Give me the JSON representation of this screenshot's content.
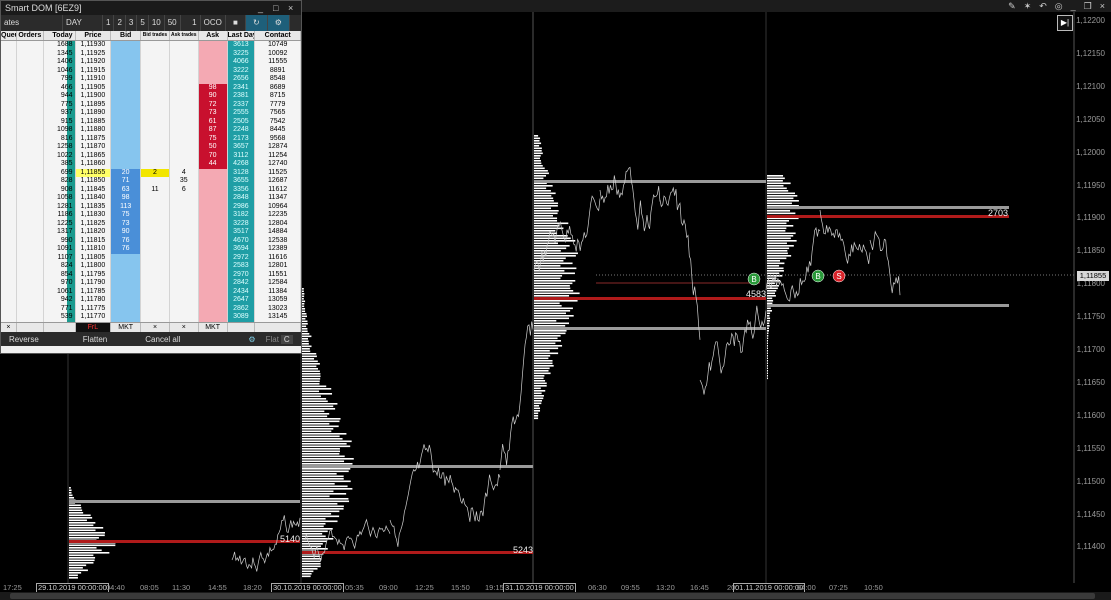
{
  "window": {
    "title": "Smart DOM [6EZ9]",
    "controls": [
      "_",
      "□",
      "×"
    ]
  },
  "dom_toolbar": {
    "account": "ates",
    "period": "DAY",
    "quantities": [
      "1",
      "2",
      "3",
      "5",
      "10",
      "50"
    ],
    "quantity_value": "1",
    "oco": "OCO"
  },
  "dom_columns": [
    "Queue",
    "Orders",
    "Today",
    "Price",
    "Bid",
    "Bid trades",
    "Ask trades",
    "Ask",
    "Last Day",
    "Contact"
  ],
  "dom_rows": [
    {
      "today": "1688",
      "price": "1,11930",
      "bid": "",
      "bidtr": "",
      "asktr": "",
      "ask": "",
      "last": "3613",
      "contact": "10749"
    },
    {
      "today": "1345",
      "price": "1,11925",
      "bid": "",
      "bidtr": "",
      "asktr": "",
      "ask": "",
      "last": "3225",
      "contact": "10092"
    },
    {
      "today": "1406",
      "price": "1,11920",
      "bid": "",
      "bidtr": "",
      "asktr": "",
      "ask": "",
      "last": "4066",
      "contact": "11555"
    },
    {
      "today": "1046",
      "price": "1,11915",
      "bid": "",
      "bidtr": "",
      "asktr": "",
      "ask": "",
      "last": "3222",
      "contact": "8891"
    },
    {
      "today": "799",
      "price": "1,11910",
      "bid": "",
      "bidtr": "",
      "asktr": "",
      "ask": "",
      "last": "2656",
      "contact": "8548"
    },
    {
      "today": "466",
      "price": "1,11905",
      "bid": "",
      "bidtr": "",
      "asktr": "",
      "ask": "98",
      "last": "2341",
      "contact": "8689"
    },
    {
      "today": "944",
      "price": "1,11900",
      "bid": "",
      "bidtr": "",
      "asktr": "",
      "ask": "90",
      "last": "2381",
      "contact": "8715"
    },
    {
      "today": "775",
      "price": "1,11895",
      "bid": "",
      "bidtr": "",
      "asktr": "",
      "ask": "72",
      "last": "2337",
      "contact": "7779"
    },
    {
      "today": "937",
      "price": "1,11890",
      "bid": "",
      "bidtr": "",
      "asktr": "",
      "ask": "73",
      "last": "2555",
      "contact": "7565"
    },
    {
      "today": "915",
      "price": "1,11885",
      "bid": "",
      "bidtr": "",
      "asktr": "",
      "ask": "61",
      "last": "2505",
      "contact": "7542"
    },
    {
      "today": "1098",
      "price": "1,11880",
      "bid": "",
      "bidtr": "",
      "asktr": "",
      "ask": "87",
      "last": "2248",
      "contact": "8445"
    },
    {
      "today": "816",
      "price": "1,11875",
      "bid": "",
      "bidtr": "",
      "asktr": "",
      "ask": "75",
      "last": "2173",
      "contact": "9568"
    },
    {
      "today": "1258",
      "price": "1,11870",
      "bid": "",
      "bidtr": "",
      "asktr": "",
      "ask": "50",
      "last": "3657",
      "contact": "12874"
    },
    {
      "today": "1022",
      "price": "1,11865",
      "bid": "",
      "bidtr": "",
      "asktr": "",
      "ask": "70",
      "last": "3112",
      "contact": "11254"
    },
    {
      "today": "385",
      "price": "1,11860",
      "bid": "",
      "bidtr": "",
      "asktr": "",
      "ask": "44",
      "last": "4268",
      "contact": "12740"
    },
    {
      "today": "699",
      "price": "1,11855",
      "bid": "20",
      "bidtr": "2",
      "asktr": "4",
      "ask": "",
      "last": "3128",
      "contact": "11525"
    },
    {
      "today": "828",
      "price": "1,11850",
      "bid": "71",
      "bidtr": "",
      "asktr": "35",
      "ask": "",
      "last": "3655",
      "contact": "12687"
    },
    {
      "today": "908",
      "price": "1,11845",
      "bid": "63",
      "bidtr": "11",
      "asktr": "6",
      "ask": "",
      "last": "3356",
      "contact": "11612"
    },
    {
      "today": "1058",
      "price": "1,11840",
      "bid": "98",
      "bidtr": "",
      "asktr": "",
      "ask": "",
      "last": "2848",
      "contact": "11347"
    },
    {
      "today": "1281",
      "price": "1,11835",
      "bid": "113",
      "bidtr": "",
      "asktr": "",
      "ask": "",
      "last": "2986",
      "contact": "10964"
    },
    {
      "today": "1186",
      "price": "1,11830",
      "bid": "75",
      "bidtr": "",
      "asktr": "",
      "ask": "",
      "last": "3182",
      "contact": "12235"
    },
    {
      "today": "1225",
      "price": "1,11825",
      "bid": "73",
      "bidtr": "",
      "asktr": "",
      "ask": "",
      "last": "3228",
      "contact": "12804"
    },
    {
      "today": "1317",
      "price": "1,11820",
      "bid": "90",
      "bidtr": "",
      "asktr": "",
      "ask": "",
      "last": "3517",
      "contact": "14884"
    },
    {
      "today": "990",
      "price": "1,11815",
      "bid": "76",
      "bidtr": "",
      "asktr": "",
      "ask": "",
      "last": "4670",
      "contact": "12538"
    },
    {
      "today": "1091",
      "price": "1,11810",
      "bid": "76",
      "bidtr": "",
      "asktr": "",
      "ask": "",
      "last": "3694",
      "contact": "12389"
    },
    {
      "today": "1107",
      "price": "1,11805",
      "bid": "",
      "bidtr": "",
      "asktr": "",
      "ask": "",
      "last": "2972",
      "contact": "11616"
    },
    {
      "today": "824",
      "price": "1,11800",
      "bid": "",
      "bidtr": "",
      "asktr": "",
      "ask": "",
      "last": "2583",
      "contact": "12801"
    },
    {
      "today": "854",
      "price": "1,11795",
      "bid": "",
      "bidtr": "",
      "asktr": "",
      "ask": "",
      "last": "2970",
      "contact": "11551"
    },
    {
      "today": "970",
      "price": "1,11790",
      "bid": "",
      "bidtr": "",
      "asktr": "",
      "ask": "",
      "last": "2842",
      "contact": "12584"
    },
    {
      "today": "1061",
      "price": "1,11785",
      "bid": "",
      "bidtr": "",
      "asktr": "",
      "ask": "",
      "last": "2434",
      "contact": "11384"
    },
    {
      "today": "942",
      "price": "1,11780",
      "bid": "",
      "bidtr": "",
      "asktr": "",
      "ask": "",
      "last": "2647",
      "contact": "13059"
    },
    {
      "today": "771",
      "price": "1,11775",
      "bid": "",
      "bidtr": "",
      "asktr": "",
      "ask": "",
      "last": "2862",
      "contact": "13023"
    },
    {
      "today": "539",
      "price": "1,11770",
      "bid": "",
      "bidtr": "",
      "asktr": "",
      "ask": "",
      "last": "3089",
      "contact": "13145"
    },
    {
      "today": "603",
      "price": "",
      "bid": "",
      "bidtr": "",
      "asktr": "",
      "ask": "",
      "last": "1703",
      "contact": "11234"
    }
  ],
  "dom_footer_row": {
    "queue": "×",
    "price": "FrL",
    "bid": "MKT",
    "bidtr": "×",
    "asktr": "×",
    "ask": "MKT"
  },
  "dom_bottom": {
    "reverse": "Reverse",
    "flatten": "Flatten",
    "cancel": "Cancel all",
    "flat": "Flat",
    "c": "C"
  },
  "price_axis": [
    "1,12200",
    "1,12150",
    "1,12100",
    "1,12050",
    "1,12000",
    "1,11950",
    "1,11900",
    "1,11850",
    "1,11800",
    "1,11750",
    "1,11700",
    "1,11650",
    "1,11600",
    "1,11550",
    "1,11500",
    "1,11450",
    "1,11400"
  ],
  "current_price": "1,11855",
  "time_axis": [
    {
      "label": "17:25",
      "boxed": false
    },
    {
      "label": "29.10.2019 00:00:00",
      "boxed": true
    },
    {
      "label": "04:40",
      "boxed": false
    },
    {
      "label": "08:05",
      "boxed": false
    },
    {
      "label": "11:30",
      "boxed": false
    },
    {
      "label": "14:55",
      "boxed": false
    },
    {
      "label": "18:20",
      "boxed": false
    },
    {
      "label": "30.10.2019 00:00:00",
      "boxed": true
    },
    {
      "label": "05:35",
      "boxed": false
    },
    {
      "label": "09:00",
      "boxed": false
    },
    {
      "label": "12:25",
      "boxed": false
    },
    {
      "label": "15:50",
      "boxed": false
    },
    {
      "label": "19:15",
      "boxed": false
    },
    {
      "label": "31.10.2019 00:00:00",
      "boxed": true
    },
    {
      "label": "06:30",
      "boxed": false
    },
    {
      "label": "09:55",
      "boxed": false
    },
    {
      "label": "13:20",
      "boxed": false
    },
    {
      "label": "16:45",
      "boxed": false
    },
    {
      "label": "20:",
      "boxed": false
    },
    {
      "label": "01.11.2019 00:00:00",
      "boxed": true
    },
    {
      "label": "04:00",
      "boxed": false
    },
    {
      "label": "07:25",
      "boxed": false
    },
    {
      "label": "10:50",
      "boxed": false
    }
  ],
  "volume_labels": [
    "5140",
    "5243",
    "4583",
    "2703"
  ],
  "trade_markers": [
    "B",
    "B",
    "S"
  ],
  "colors": {
    "background": "#000000",
    "poc": "#b01a1a",
    "value_area": "#9a9a9a",
    "bid": "#86c5ee",
    "ask": "#f4a9b3",
    "last_day": "#1f9ea5",
    "buy_marker": "#2a9a3a",
    "sell_marker": "#d9232a"
  },
  "topbar_icons": [
    "drawing-tools-icon",
    "indicators-icon",
    "undo-icon",
    "camera-icon",
    "minimize-icon",
    "restore-icon",
    "close-icon"
  ],
  "topbar_glyphs": [
    "✎",
    "✶",
    "↶",
    "◎",
    "_",
    "❐",
    "×"
  ],
  "autoscroll_glyph": "▶|"
}
